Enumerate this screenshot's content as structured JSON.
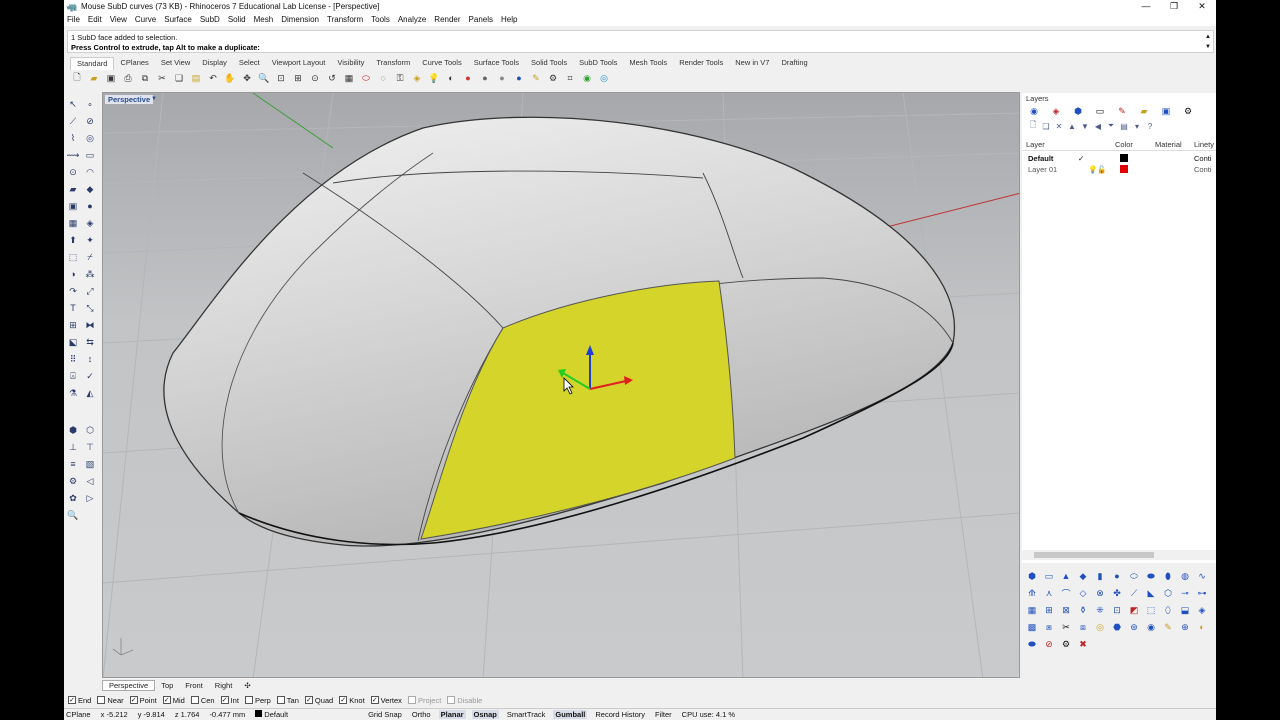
{
  "window": {
    "title": "Mouse SubD curves (73 KB) - Rhinoceros 7 Educational Lab License - [Perspective]"
  },
  "menu": [
    "File",
    "Edit",
    "View",
    "Curve",
    "Surface",
    "SubD",
    "Solid",
    "Mesh",
    "Dimension",
    "Transform",
    "Tools",
    "Analyze",
    "Render",
    "Panels",
    "Help"
  ],
  "command": {
    "history": "1 SubD face added to selection.",
    "prompt": "Press Control to extrude, tap Alt to make a duplicate:"
  },
  "tabs": [
    "Standard",
    "CPlanes",
    "Set View",
    "Display",
    "Select",
    "Viewport Layout",
    "Visibility",
    "Transform",
    "Curve Tools",
    "Surface Tools",
    "Solid Tools",
    "SubD Tools",
    "Mesh Tools",
    "Render Tools",
    "New in V7",
    "Drafting"
  ],
  "toolbar_icons": [
    "new-icon",
    "open-icon",
    "save-icon",
    "print-icon",
    "import-icon",
    "cut-icon",
    "copy-icon",
    "paste-icon",
    "undo-icon",
    "pan-icon",
    "rotate-icon",
    "zoom-icon",
    "zoom-window-icon",
    "zoom-extents-icon",
    "zoom-selected-icon",
    "undo-view-icon",
    "grid-icon",
    "select-points-icon",
    "hide-icon",
    "lock-icon",
    "layer-icon",
    "light-icon",
    "properties-icon",
    "wire-icon",
    "shaded-icon",
    "rendered-icon",
    "render-icon",
    "material-icon",
    "gumball-icon",
    "cplane-icon",
    "snap-icon",
    "record-icon"
  ],
  "viewport": {
    "label": "Perspective"
  },
  "view_tabs": [
    "Perspective",
    "Top",
    "Front",
    "Right"
  ],
  "osnaps": [
    {
      "label": "End",
      "checked": true
    },
    {
      "label": "Near",
      "checked": false
    },
    {
      "label": "Point",
      "checked": true
    },
    {
      "label": "Mid",
      "checked": true
    },
    {
      "label": "Cen",
      "checked": false
    },
    {
      "label": "Int",
      "checked": true
    },
    {
      "label": "Perp",
      "checked": false
    },
    {
      "label": "Tan",
      "checked": false
    },
    {
      "label": "Quad",
      "checked": true
    },
    {
      "label": "Knot",
      "checked": true
    },
    {
      "label": "Vertex",
      "checked": true
    },
    {
      "label": "Project",
      "checked": false
    },
    {
      "label": "Disable",
      "checked": false
    }
  ],
  "status": {
    "cplane": "CPlane",
    "x": "x -5.212",
    "y": "y -9.814",
    "z": "z 1.764",
    "dist": "-0.477 mm",
    "layer": "Default",
    "grid_snap": "Grid Snap",
    "ortho": "Ortho",
    "planar": "Planar",
    "osnap": "Osnap",
    "smarttrack": "SmartTrack",
    "gumball": "Gumball",
    "record": "Record History",
    "filter": "Filter",
    "cpu": "CPU use: 4.1 %"
  },
  "layers": {
    "panel_title": "Layers",
    "columns": [
      "Layer",
      "Color",
      "Material",
      "Linety"
    ],
    "rows": [
      {
        "name": "Default",
        "current": true,
        "color": "#000000",
        "linetype": "Conti"
      },
      {
        "name": "Layer 01",
        "current": false,
        "color": "#e00000",
        "linetype": "Conti"
      }
    ]
  },
  "colors": {
    "selected_face": "#d4d42a",
    "gumball_z": "#1f3fd8",
    "gumball_x": "#e02020",
    "gumball_y": "#22cc22"
  }
}
